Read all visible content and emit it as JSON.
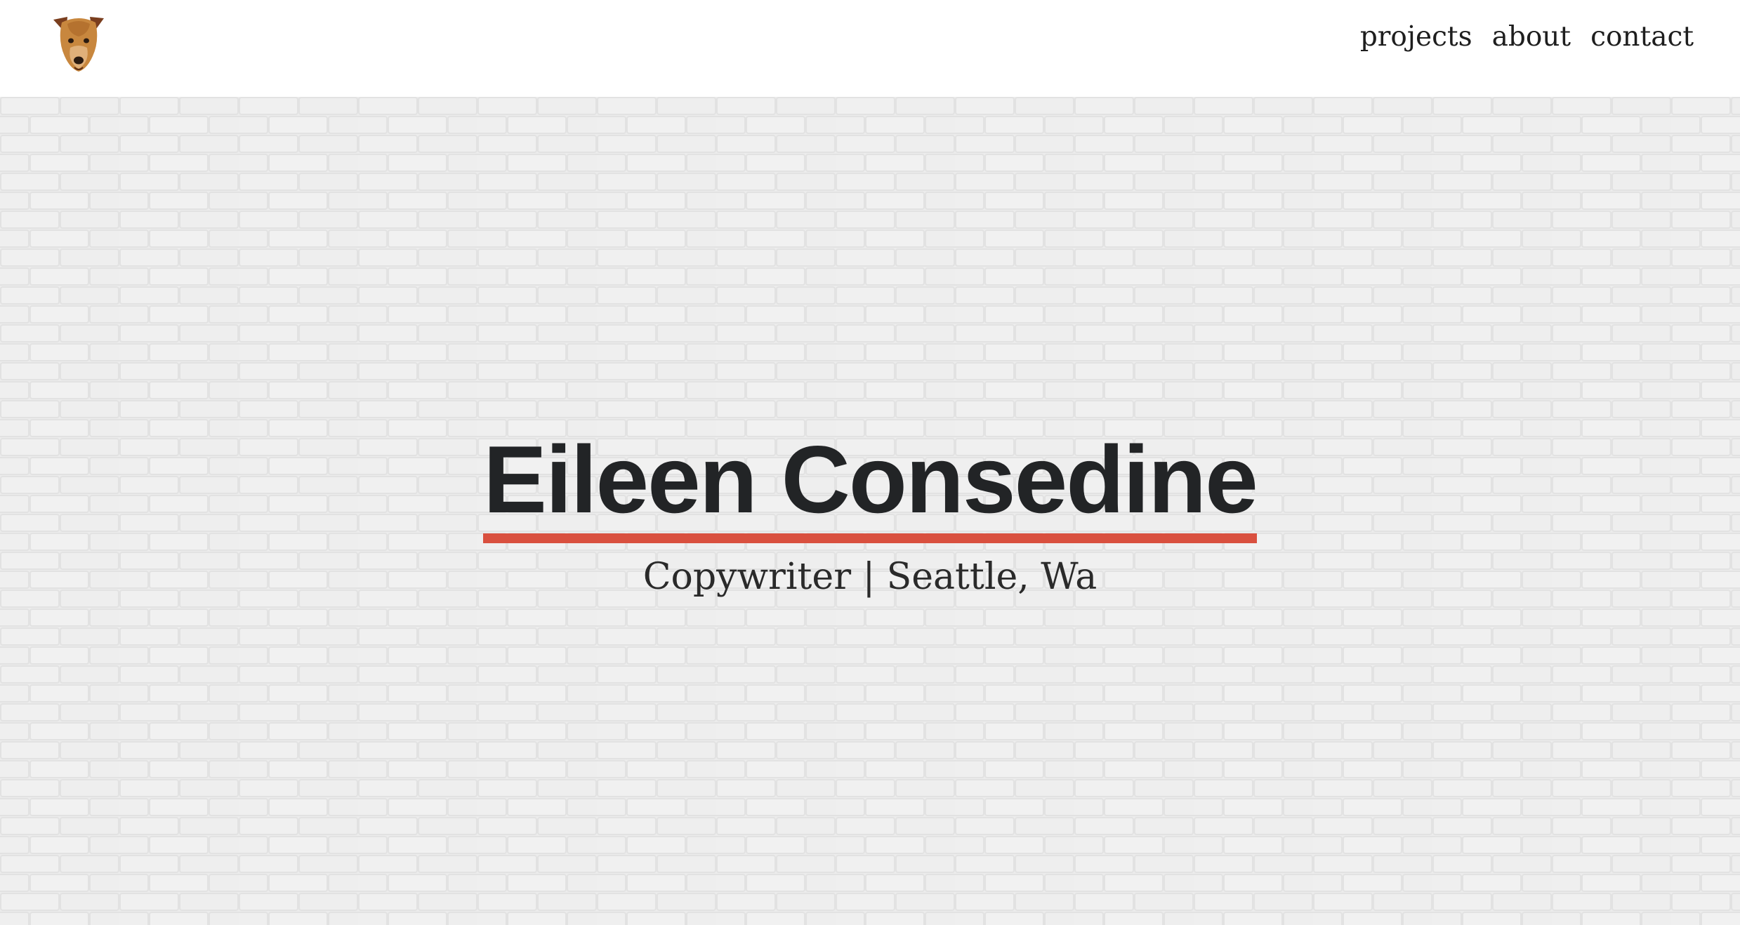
{
  "header": {
    "logo_icon": "dog-head-icon",
    "nav": [
      {
        "label": "projects"
      },
      {
        "label": "about"
      },
      {
        "label": "contact"
      }
    ]
  },
  "hero": {
    "name": "Eileen Consedine",
    "tagline": "Copywriter | Seattle, Wa",
    "background": "white-brick-wall",
    "accent_color": "#d9503f",
    "text_color": "#222426"
  }
}
